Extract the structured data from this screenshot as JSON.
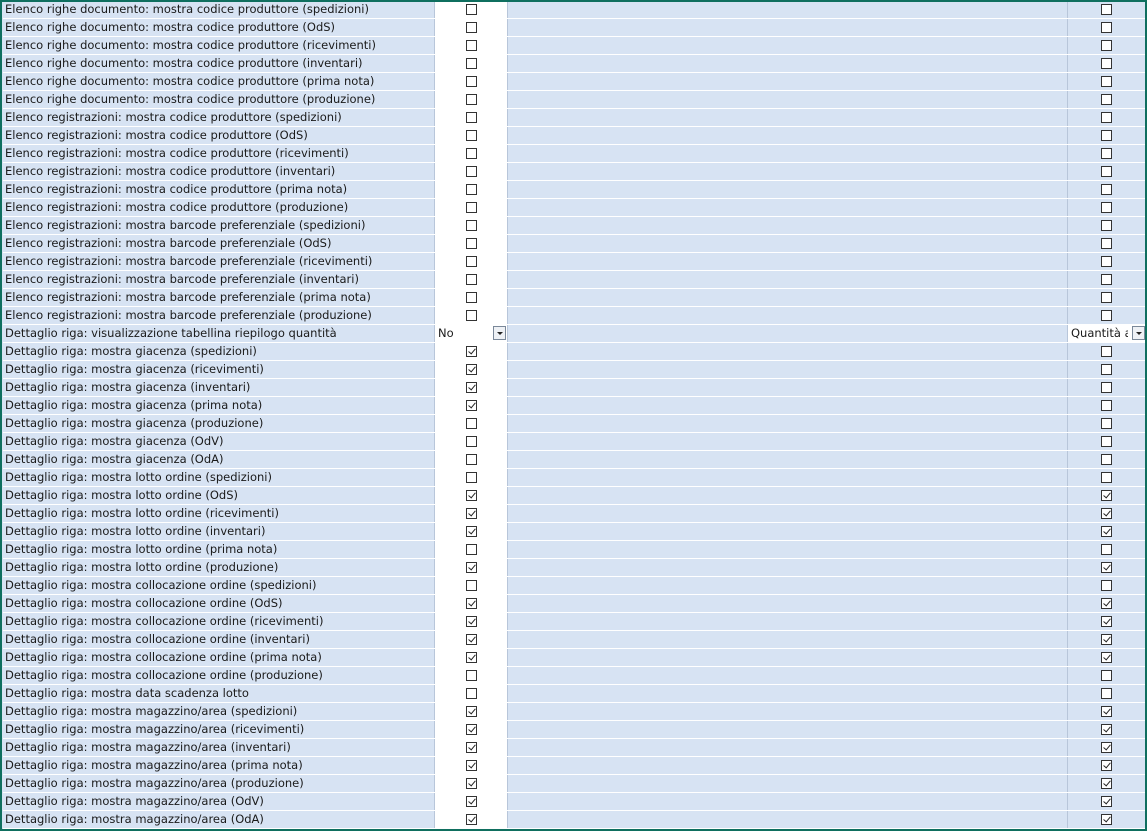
{
  "rows": [
    {
      "label": "Elenco righe documento: mostra codice produttore (spedizioni)",
      "v1": false,
      "v2": false
    },
    {
      "label": "Elenco righe documento: mostra codice produttore (OdS)",
      "v1": false,
      "v2": false
    },
    {
      "label": "Elenco righe documento: mostra codice produttore (ricevimenti)",
      "v1": false,
      "v2": false
    },
    {
      "label": "Elenco righe documento: mostra codice produttore (inventari)",
      "v1": false,
      "v2": false
    },
    {
      "label": "Elenco righe documento: mostra codice produttore (prima nota)",
      "v1": false,
      "v2": false
    },
    {
      "label": "Elenco righe documento: mostra codice produttore (produzione)",
      "v1": false,
      "v2": false
    },
    {
      "label": "Elenco registrazioni: mostra codice produttore (spedizioni)",
      "v1": false,
      "v2": false
    },
    {
      "label": "Elenco registrazioni: mostra codice produttore (OdS)",
      "v1": false,
      "v2": false
    },
    {
      "label": "Elenco registrazioni: mostra codice produttore (ricevimenti)",
      "v1": false,
      "v2": false
    },
    {
      "label": "Elenco registrazioni: mostra codice produttore (inventari)",
      "v1": false,
      "v2": false
    },
    {
      "label": "Elenco registrazioni: mostra codice produttore (prima nota)",
      "v1": false,
      "v2": false
    },
    {
      "label": "Elenco registrazioni: mostra codice produttore (produzione)",
      "v1": false,
      "v2": false
    },
    {
      "label": "Elenco registrazioni: mostra barcode preferenziale (spedizioni)",
      "v1": false,
      "v2": false
    },
    {
      "label": "Elenco registrazioni: mostra barcode preferenziale (OdS)",
      "v1": false,
      "v2": false
    },
    {
      "label": "Elenco registrazioni: mostra barcode preferenziale (ricevimenti)",
      "v1": false,
      "v2": false
    },
    {
      "label": "Elenco registrazioni: mostra barcode preferenziale (inventari)",
      "v1": false,
      "v2": false
    },
    {
      "label": "Elenco registrazioni: mostra barcode preferenziale (prima nota)",
      "v1": false,
      "v2": false
    },
    {
      "label": "Elenco registrazioni: mostra barcode preferenziale (produzione)",
      "v1": false,
      "v2": false
    },
    {
      "label": "Dettaglio riga: visualizzazione tabellina riepilogo quantità",
      "combo1": "No",
      "combo2": "Quantità a"
    },
    {
      "label": "Dettaglio riga: mostra giacenza (spedizioni)",
      "v1": true,
      "v2": false
    },
    {
      "label": "Dettaglio riga: mostra giacenza (ricevimenti)",
      "v1": true,
      "v2": false
    },
    {
      "label": "Dettaglio riga: mostra giacenza (inventari)",
      "v1": true,
      "v2": false
    },
    {
      "label": "Dettaglio riga: mostra giacenza (prima nota)",
      "v1": true,
      "v2": false
    },
    {
      "label": "Dettaglio riga: mostra giacenza (produzione)",
      "v1": false,
      "v2": false
    },
    {
      "label": "Dettaglio riga: mostra giacenza (OdV)",
      "v1": false,
      "v2": false
    },
    {
      "label": "Dettaglio riga: mostra giacenza (OdA)",
      "v1": false,
      "v2": false
    },
    {
      "label": "Dettaglio riga: mostra lotto ordine (spedizioni)",
      "v1": false,
      "v2": false
    },
    {
      "label": "Dettaglio riga: mostra lotto ordine (OdS)",
      "v1": true,
      "v2": true
    },
    {
      "label": "Dettaglio riga: mostra lotto ordine (ricevimenti)",
      "v1": true,
      "v2": true
    },
    {
      "label": "Dettaglio riga: mostra lotto ordine (inventari)",
      "v1": true,
      "v2": true
    },
    {
      "label": "Dettaglio riga: mostra lotto ordine (prima nota)",
      "v1": false,
      "v2": false
    },
    {
      "label": "Dettaglio riga: mostra lotto ordine (produzione)",
      "v1": true,
      "v2": true
    },
    {
      "label": "Dettaglio riga: mostra collocazione ordine (spedizioni)",
      "v1": false,
      "v2": false
    },
    {
      "label": "Dettaglio riga: mostra collocazione ordine (OdS)",
      "v1": true,
      "v2": true
    },
    {
      "label": "Dettaglio riga: mostra collocazione ordine (ricevimenti)",
      "v1": true,
      "v2": true
    },
    {
      "label": "Dettaglio riga: mostra collocazione ordine (inventari)",
      "v1": true,
      "v2": true
    },
    {
      "label": "Dettaglio riga: mostra collocazione ordine (prima nota)",
      "v1": true,
      "v2": true
    },
    {
      "label": "Dettaglio riga: mostra collocazione ordine (produzione)",
      "v1": false,
      "v2": false
    },
    {
      "label": "Dettaglio riga: mostra data scadenza lotto",
      "v1": false,
      "v2": false
    },
    {
      "label": "Dettaglio riga: mostra magazzino/area (spedizioni)",
      "v1": true,
      "v2": true
    },
    {
      "label": "Dettaglio riga: mostra magazzino/area (ricevimenti)",
      "v1": true,
      "v2": true
    },
    {
      "label": "Dettaglio riga: mostra magazzino/area (inventari)",
      "v1": true,
      "v2": true
    },
    {
      "label": "Dettaglio riga: mostra magazzino/area (prima nota)",
      "v1": true,
      "v2": true
    },
    {
      "label": "Dettaglio riga: mostra magazzino/area (produzione)",
      "v1": true,
      "v2": true
    },
    {
      "label": "Dettaglio riga: mostra magazzino/area (OdV)",
      "v1": true,
      "v2": true
    },
    {
      "label": "Dettaglio riga: mostra magazzino/area (OdA)",
      "v1": true,
      "v2": true
    }
  ]
}
